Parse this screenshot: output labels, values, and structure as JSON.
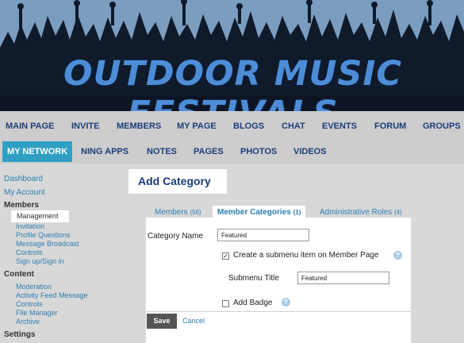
{
  "banner": {
    "title": "OUTDOOR MUSIC FESTIVALS"
  },
  "nav_main": [
    "MAIN PAGE",
    "INVITE",
    "MEMBERS",
    "MY PAGE",
    "BLOGS",
    "CHAT",
    "EVENTS",
    "FORUM",
    "GROUPS"
  ],
  "nav_sub": {
    "active": "MY NETWORK",
    "items": [
      "NING APPS",
      "NOTES",
      "PAGES",
      "PHOTOS",
      "VIDEOS"
    ]
  },
  "sidebar": {
    "dashboard": "Dashboard",
    "my_account": "My Account",
    "members_head": "Members",
    "members_items": [
      "Management",
      "Invitation",
      "Profile Questions",
      "Message Broadcast",
      "Controls",
      "Sign up/Sign in"
    ],
    "content_head": "Content",
    "content_items": [
      "Moderation",
      "Activity Feed Message",
      "Controls",
      "File Manager",
      "Archive"
    ],
    "settings_head": "Settings"
  },
  "page_title": "Add Category",
  "tabs": [
    {
      "label": "Members",
      "count": "(56)"
    },
    {
      "label": "Member Categories",
      "count": "(1)"
    },
    {
      "label": "Administrative Roles",
      "count": "(4)"
    }
  ],
  "form": {
    "category_name_label": "Category Name",
    "category_name_value": "Featured",
    "submenu_checkbox_label": "Create a submenu item on Member Page",
    "submenu_checked": true,
    "submenu_title_label": "Submenu Title",
    "submenu_title_value": "Featured",
    "badge_checkbox_label": "Add Badge",
    "badge_checked": false,
    "help_glyph": "?",
    "check_glyph": "✓",
    "save_label": "Save",
    "cancel_label": "Cancel"
  }
}
